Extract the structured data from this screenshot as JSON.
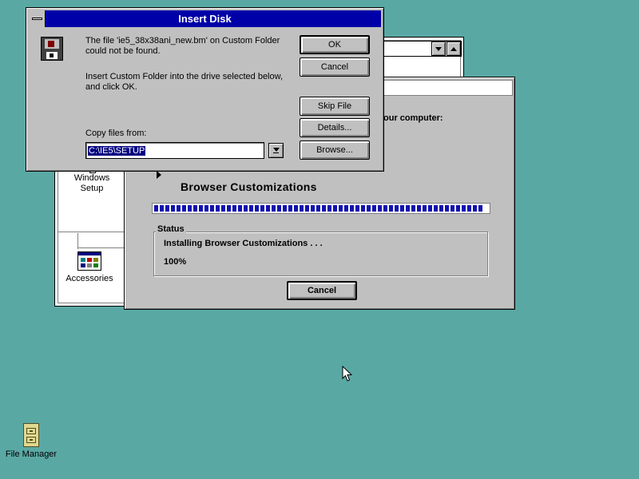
{
  "insert_disk": {
    "title": "Insert Disk",
    "message_line1": "The file 'ie5_38x38ani_new.bm' on Custom Folder",
    "message_line2": "could not be found.",
    "instruction_line1": "Insert Custom Folder into the drive selected below,",
    "instruction_line2": "and click OK.",
    "copy_from_label": "Copy files from:",
    "copy_from_value": "C:\\IE5\\SETUP",
    "buttons": {
      "ok": "OK",
      "cancel": "Cancel",
      "skip_file": "Skip File",
      "details": "Details...",
      "browse": "Browse..."
    }
  },
  "setup_window": {
    "partial_heading": "our computer:",
    "current_step": "Browser Customizations",
    "progress_percent": 100,
    "status_label": "Status",
    "status_text": "Installing Browser Customizations . . .",
    "status_percent": "100%",
    "cancel_label": "Cancel"
  },
  "program_manager": {
    "groups": [
      {
        "label_line1": "Windows",
        "label_line2": "Setup",
        "icon": "windows-setup-icon"
      },
      {
        "label_line1": "Accessories",
        "label_line2": "",
        "icon": "accessories-icon"
      }
    ]
  },
  "desktop": {
    "icons": [
      {
        "label": "File Manager",
        "icon": "file-cabinet-icon"
      }
    ],
    "background_color": "#5aa8a4"
  }
}
